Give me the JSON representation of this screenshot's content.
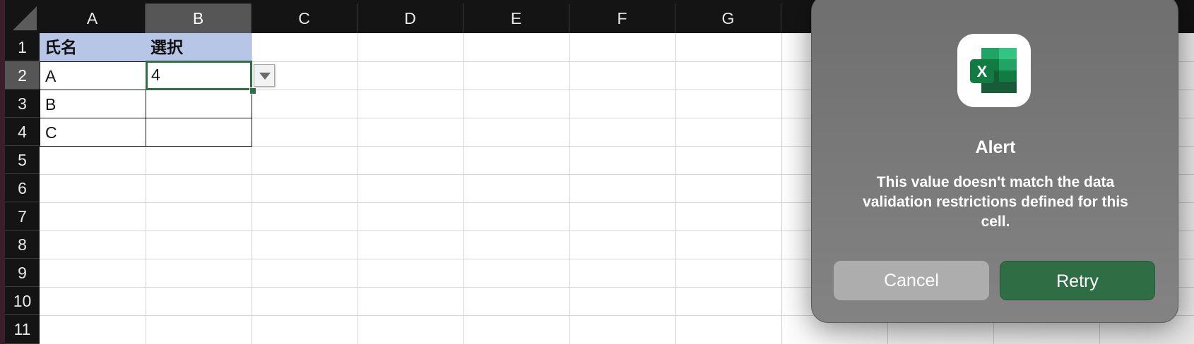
{
  "spreadsheet": {
    "columns": [
      "A",
      "B",
      "C",
      "D",
      "E",
      "F",
      "G"
    ],
    "rows": [
      "1",
      "2",
      "3",
      "4",
      "5",
      "6",
      "7",
      "8",
      "9",
      "10",
      "11"
    ],
    "cells": {
      "A1": "氏名",
      "B1": "選択",
      "A2": "A",
      "B2": "4",
      "A3": "B",
      "A4": "C"
    },
    "selected_cell": "B2"
  },
  "dialog": {
    "icon": "excel-app-icon",
    "title": "Alert",
    "message": "This value doesn't match the data validation restrictions defined for this cell.",
    "cancel_label": "Cancel",
    "retry_label": "Retry"
  },
  "colors": {
    "header_fill": "#b7c6e6",
    "accent_green": "#2f6e44",
    "dialog_bg": "#777777"
  }
}
